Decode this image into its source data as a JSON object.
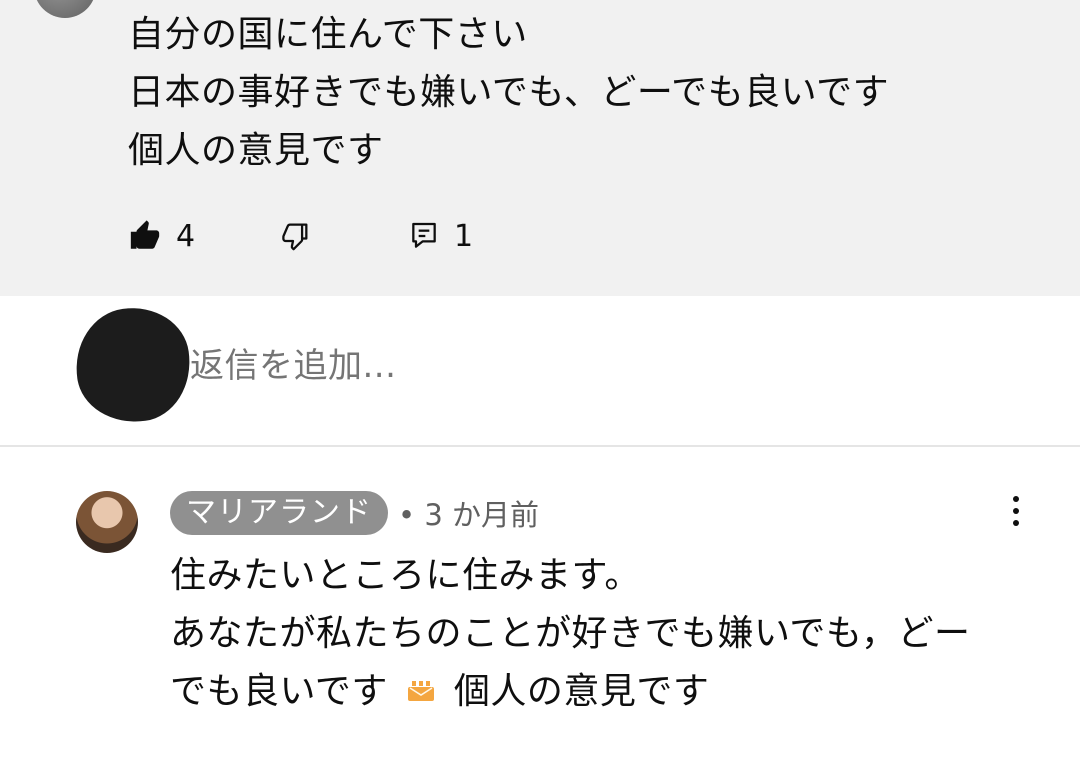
{
  "parent": {
    "lines": [
      "自分の国に住んで下さい",
      "日本の事好きでも嫌いでも、どーでも良いです",
      "個人の意見です"
    ],
    "like_count": "4",
    "reply_count": "1"
  },
  "reply_box": {
    "placeholder": "返信を追加..."
  },
  "child": {
    "author": "マリアランド",
    "meta": "• 3 か月前",
    "lines": [
      "住みたいところに住みます。",
      "あなたが私たちのことが好きでも嫌いでも，どー"
    ],
    "line3_before": "でも良いです",
    "line3_emoji": "mail-emoji",
    "line3_after": "個人の意見です"
  },
  "colors": {
    "parent_bg": "#f1f1f1",
    "chip_bg": "#909090",
    "meta_text": "#606060",
    "emoji_orange": "#f4a640"
  },
  "icons": [
    "thumb-up-icon",
    "thumb-down-icon",
    "reply-icon",
    "more-vertical-icon"
  ]
}
